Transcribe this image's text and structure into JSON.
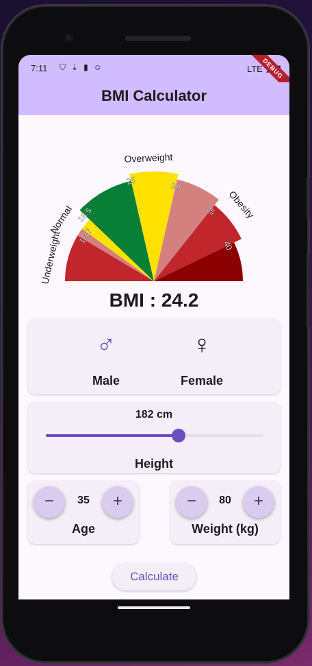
{
  "status_bar": {
    "time": "7:11",
    "network": "LTE",
    "debug_label": "DEBUG"
  },
  "app_bar": {
    "title": "BMI Calculator"
  },
  "gauge": {
    "ranges": [
      {
        "from": 10,
        "to": 16,
        "color": "#c0262c"
      },
      {
        "from": 16,
        "to": 17,
        "color": "#d4807f"
      },
      {
        "from": 17,
        "to": 18.5,
        "color": "#ffe100"
      },
      {
        "from": 18.5,
        "to": 25,
        "color": "#087f36"
      },
      {
        "from": 25,
        "to": 30,
        "color": "#ffe100"
      },
      {
        "from": 30,
        "to": 35,
        "color": "#d4807f"
      },
      {
        "from": 35,
        "to": 40,
        "color": "#c0262c"
      },
      {
        "from": 40,
        "to": 45,
        "color": "#8b0000"
      }
    ],
    "tick_labels": [
      "16",
      "17",
      "18.5",
      "25",
      "30",
      "35",
      "40"
    ],
    "category_labels": [
      "Underweight",
      "Normal",
      "Overweight",
      "Obesity"
    ],
    "min": 10,
    "max": 45,
    "value": 24.2
  },
  "result": {
    "text": "BMI : 24.2"
  },
  "gender": {
    "male": {
      "symbol": "♂",
      "label": "Male",
      "color": "#6b4fc1"
    },
    "female": {
      "symbol": "♀",
      "label": "Female",
      "color": "#1d1b20"
    }
  },
  "height": {
    "value_text": "182 cm",
    "label": "Height",
    "fraction": 0.61
  },
  "age": {
    "minus": "−",
    "plus": "+",
    "value": "35",
    "label": "Age"
  },
  "weight": {
    "minus": "−",
    "plus": "+",
    "value": "80",
    "label": "Weight (kg)"
  },
  "calculate_button": {
    "label": "Calculate"
  },
  "colors": {
    "primary": "#6b4fc1",
    "app_bar": "#d0bcfe",
    "surface": "#fdf8fe",
    "card": "#f4eef8"
  }
}
